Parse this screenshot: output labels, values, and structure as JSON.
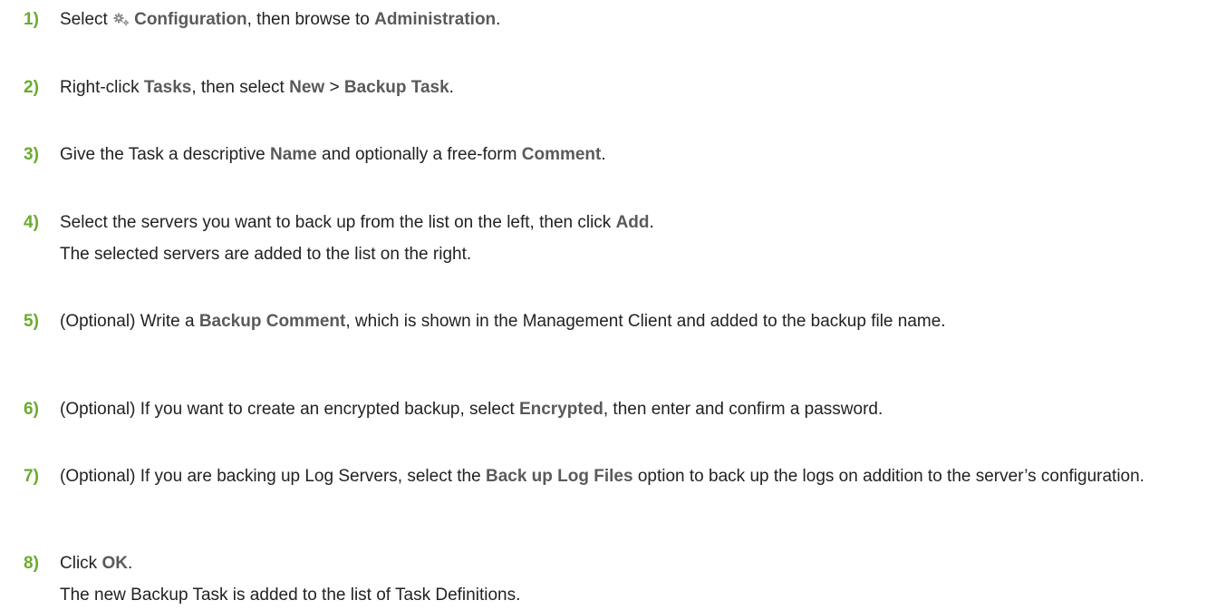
{
  "steps": [
    {
      "number": "1)",
      "parts": [
        "Select ",
        "Configuration",
        ", then browse to ",
        "Administration",
        "."
      ],
      "icon": "gear-icon"
    },
    {
      "number": "2)",
      "parts": [
        "Right-click ",
        "Tasks",
        ", then select ",
        "New",
        " > ",
        "Backup Task",
        "."
      ]
    },
    {
      "number": "3)",
      "parts": [
        "Give the Task a descriptive ",
        "Name",
        " and optionally a free-form ",
        "Comment",
        "."
      ]
    },
    {
      "number": "4)",
      "parts": [
        "Select the servers you want to back up from the list on the left, then click ",
        "Add",
        "."
      ],
      "result": "The selected servers are added to the list on the right."
    },
    {
      "number": "5)",
      "parts": [
        "(Optional) Write a ",
        "Backup Comment",
        ", which is shown in the Management Client and added to the backup file name."
      ]
    },
    {
      "number": "6)",
      "parts": [
        "(Optional) If you want to create an encrypted backup, select ",
        "Encrypted",
        ", then enter and confirm a password."
      ]
    },
    {
      "number": "7)",
      "parts": [
        "(Optional) If you are backing up Log Servers, select the ",
        "Back up Log Files",
        " option to back up the logs on addition to the server’s configuration."
      ]
    },
    {
      "number": "8)",
      "parts": [
        "Click ",
        "OK",
        "."
      ],
      "result": "The new Backup Task is added to the list of Task Definitions."
    }
  ],
  "colors": {
    "step_number": "#6aab2e",
    "ui_term": "#5a5a5a",
    "body_text": "#222222"
  }
}
